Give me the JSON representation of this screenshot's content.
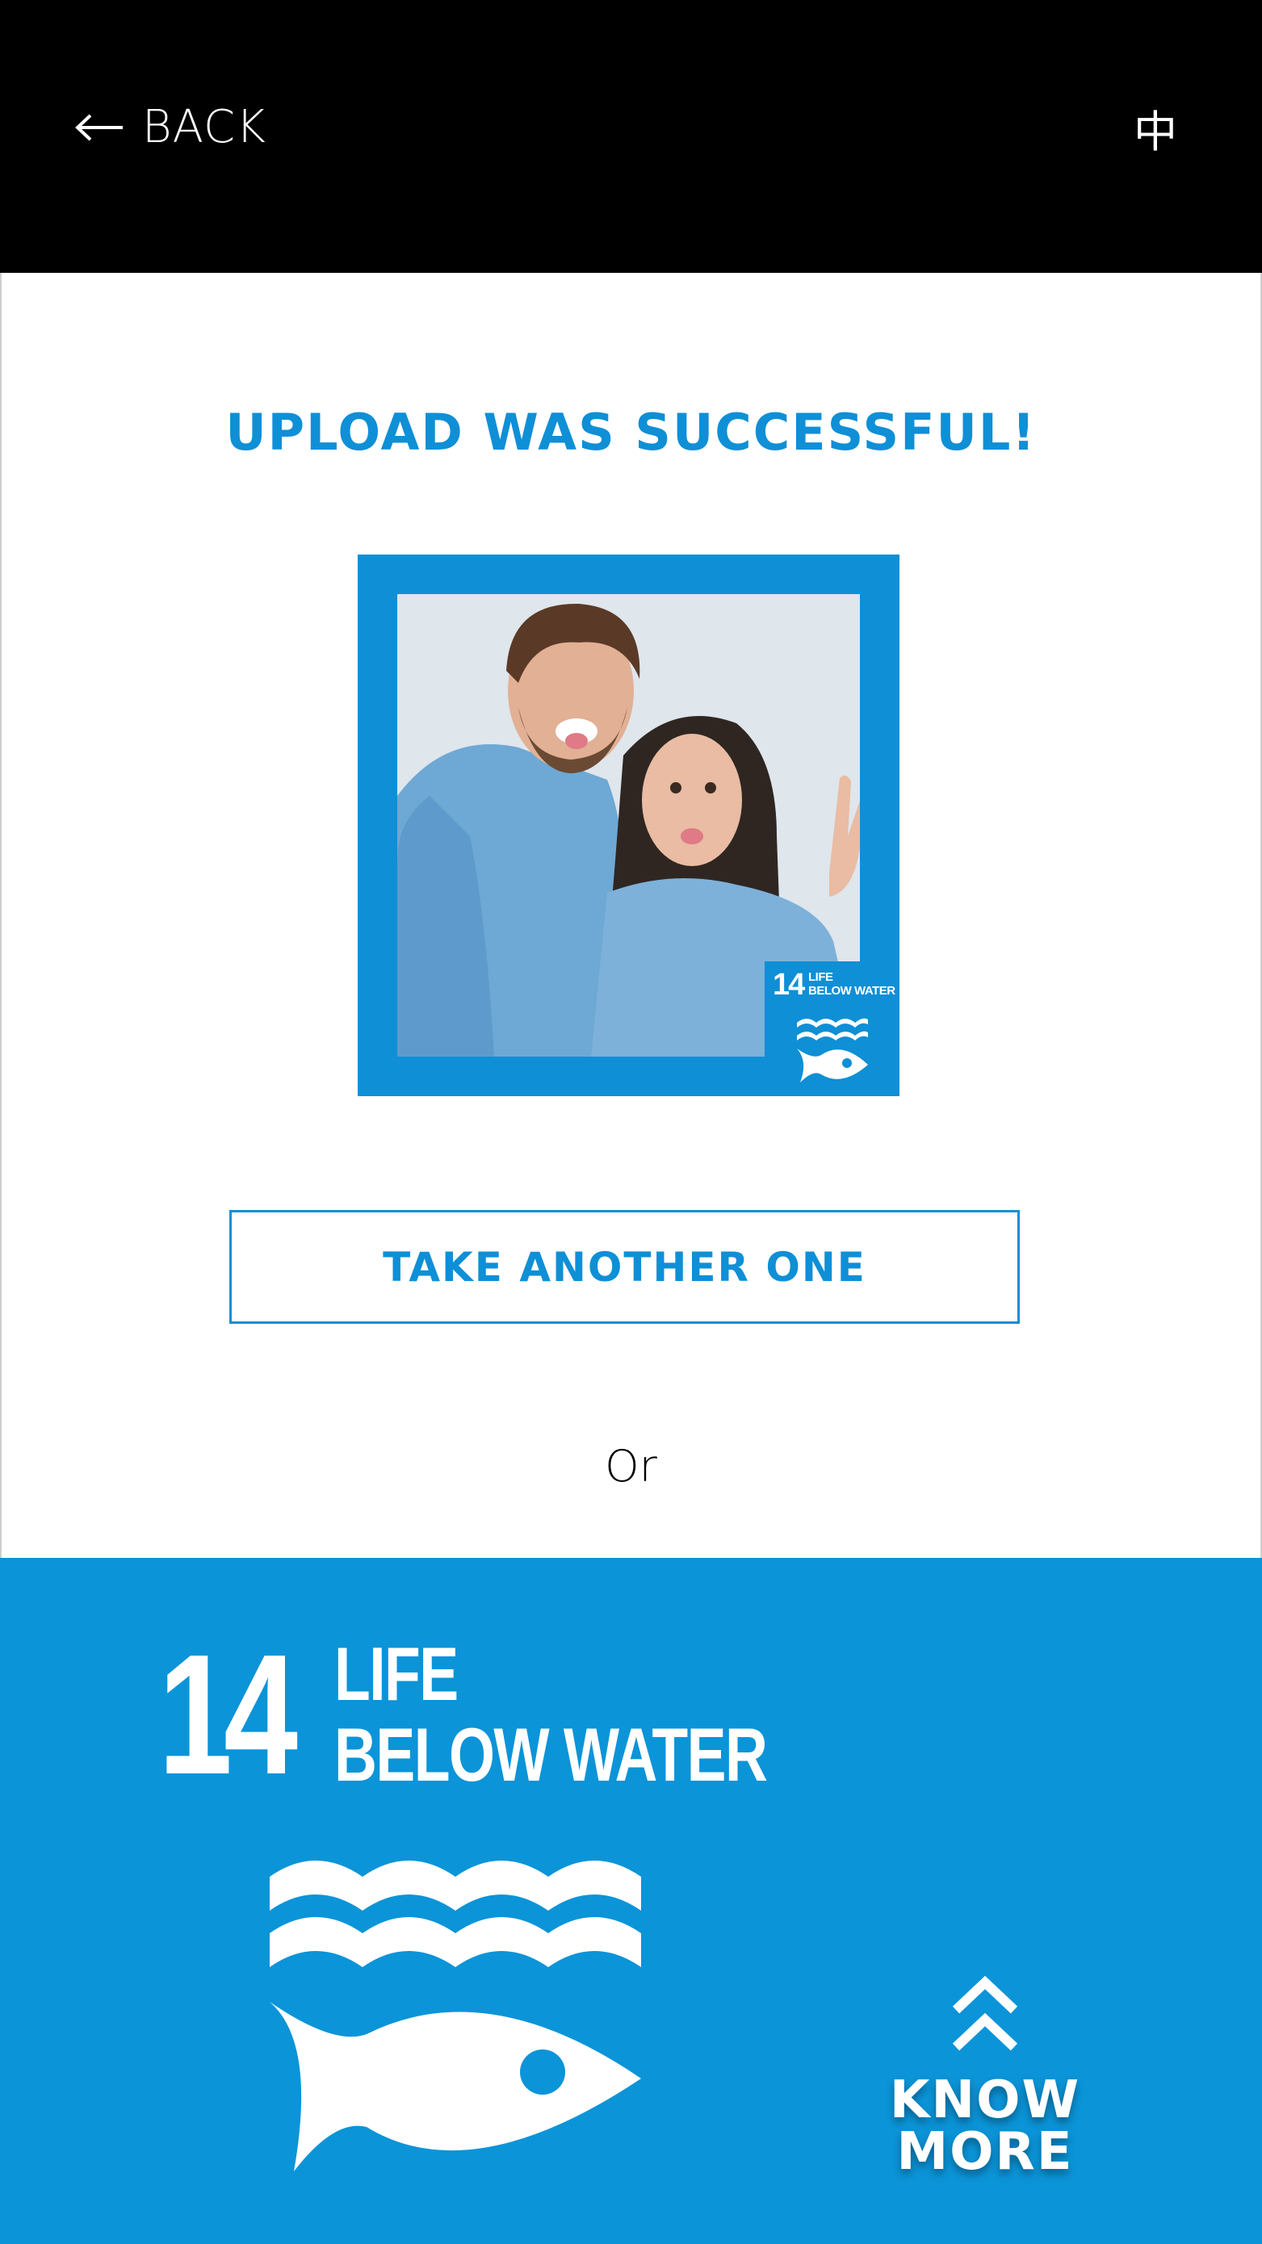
{
  "header": {
    "back_label": "BACK",
    "language_label": "中"
  },
  "main": {
    "title": "UPLOAD WAS SUCCESSFUL!",
    "photo_badge": {
      "number": "14",
      "line1": "LIFE",
      "line2": "BELOW WATER"
    },
    "take_another_label": "TAKE ANOTHER ONE",
    "or_label": "Or"
  },
  "footer": {
    "goal_number": "14",
    "goal_line1": "LIFE",
    "goal_line2": "BELOW WATER",
    "know_more_label": "KNOW MORE"
  },
  "colors": {
    "accent": "#0f8fd6",
    "footer_background": "#0b94d8",
    "header_background": "#000000"
  },
  "icons": [
    "left-arrow-icon",
    "waves-icon",
    "fish-icon",
    "double-chevron-up-icon"
  ]
}
